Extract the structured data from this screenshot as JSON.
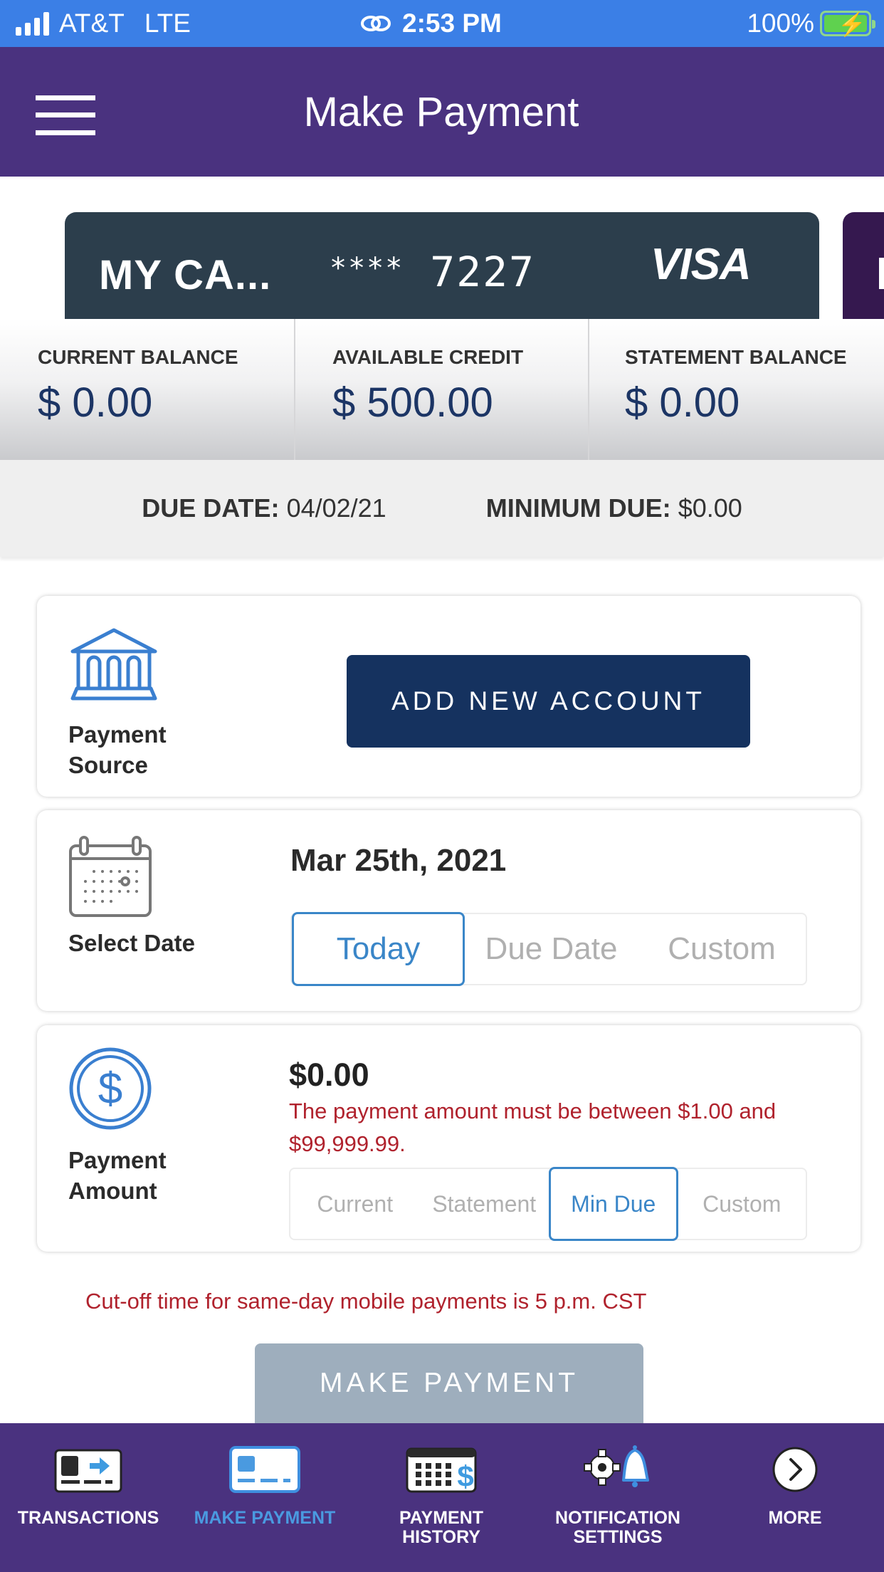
{
  "status_bar": {
    "carrier": "AT&T",
    "network": "LTE",
    "time": "2:53 PM",
    "battery": "100%",
    "battery_level": 1.0
  },
  "header": {
    "title": "Make Payment",
    "menu_icon": "hamburger-menu-icon"
  },
  "card": {
    "name": "MY CA...",
    "mask": "****",
    "last4": "7227",
    "brand": "VISA",
    "background": "#2c3e4c",
    "next_card_color": "#35184f"
  },
  "balances": [
    {
      "label": "CURRENT BALANCE",
      "value": "$ 0.00"
    },
    {
      "label": "AVAILABLE CREDIT",
      "value": "$ 500.00"
    },
    {
      "label": "STATEMENT BALANCE",
      "value": "$ 0.00"
    }
  ],
  "due": {
    "date_label": "DUE DATE:",
    "date_value": "04/02/21",
    "min_label": "MINIMUM DUE:",
    "min_value": "$0.00"
  },
  "payment_source": {
    "icon": "bank-icon",
    "label_line1": "Payment",
    "label_line2": "Source",
    "button_label": "ADD NEW ACCOUNT"
  },
  "select_date": {
    "icon": "calendar-icon",
    "label": "Select Date",
    "value": "Mar 25th, 2021",
    "options": [
      "Today",
      "Due Date",
      "Custom"
    ],
    "selected": "Today"
  },
  "payment_amount": {
    "icon": "dollar-coin-icon",
    "label_line1": "Payment",
    "label_line2": "Amount",
    "value": "$0.00",
    "error": "The payment amount must be between $1.00 and $99,999.99.",
    "options": [
      "Current",
      "Statement",
      "Min Due",
      "Custom"
    ],
    "selected": "Min Due"
  },
  "cutoff_note": "Cut-off time for same-day mobile payments is 5 p.m. CST",
  "make_payment_button": "MAKE PAYMENT",
  "bottom_nav": [
    {
      "icon": "transactions-icon",
      "label_line1": "TRANSACTIONS",
      "label_line2": "",
      "active": false
    },
    {
      "icon": "make-payment-icon",
      "label_line1": "MAKE PAYMENT",
      "label_line2": "",
      "active": true
    },
    {
      "icon": "payment-history-icon",
      "label_line1": "PAYMENT",
      "label_line2": "HISTORY",
      "active": false
    },
    {
      "icon": "notification-settings-icon",
      "label_line1": "NOTIFICATION",
      "label_line2": "SETTINGS",
      "active": false
    },
    {
      "icon": "more-icon",
      "label_line1": "MORE",
      "label_line2": "",
      "active": false
    }
  ],
  "colors": {
    "status_bar": "#3b7fe6",
    "header": "#4a327f",
    "accent_blue": "#3a86c8",
    "navy_button": "#15325f",
    "disabled_button": "#9eaebd",
    "error_red": "#b0222d",
    "balance_text": "#1c3565"
  }
}
